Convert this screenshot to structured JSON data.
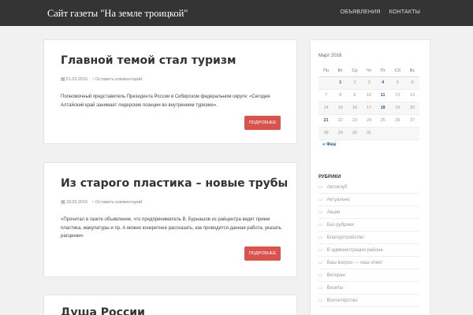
{
  "header": {
    "site_title": "Сайт газеты \"На земле троицкой\"",
    "nav": [
      "ОБЪЯВЛЕНИЯ",
      "КОНТАКТЫ"
    ]
  },
  "posts": [
    {
      "title": "Главной темой стал туризм",
      "date": "21.03.2016",
      "comment_link": "Оставить комментарий",
      "excerpt": "Полномочный представитель Президента России в Сибирском федеральном округе: «Сегодня Алтайский край занимает лидерские позиции во внутреннем туризме».",
      "more": "ПОДРОБНЕЕ"
    },
    {
      "title": "Из старого пластика – новые трубы",
      "date": "18.03.2016",
      "comment_link": "Оставить комментарий",
      "excerpt": "«Прочитал в газете объявление, что предприниматель В. Бурнашов из райцентра ведет прием пластика, макулатуры и пр. А можно конкретнее рассказать, как проводится данная работа, указать расценки»",
      "more": "ПОДРОБНЕЕ"
    },
    {
      "title": "Душа России"
    }
  ],
  "calendar": {
    "caption": "Март 2016",
    "weekdays": [
      "Пн",
      "Вт",
      "Ср",
      "Чт",
      "Пт",
      "Сб",
      "Вс"
    ],
    "weeks": [
      [
        "",
        "1",
        "2",
        "3",
        "4",
        "5",
        "6"
      ],
      [
        "7",
        "8",
        "9",
        "10",
        "11",
        "12",
        "13"
      ],
      [
        "14",
        "15",
        "16",
        "17",
        "18",
        "19",
        "20"
      ],
      [
        "21",
        "22",
        "23",
        "24",
        "25",
        "26",
        "27"
      ],
      [
        "28",
        "29",
        "30",
        "31",
        "",
        "",
        ""
      ]
    ],
    "linked_days": [
      "1",
      "4",
      "11",
      "18",
      "21"
    ],
    "prev": "« Фев"
  },
  "categories": {
    "title": "РУБРИКИ",
    "items": [
      "Автоклуб",
      "Актуально",
      "Акции",
      "Без рубрики",
      "Благоустройство",
      "В администрации района",
      "Ваш вопрос — наш ответ",
      "Ветеран",
      "Визиты",
      "Волонтёрство"
    ]
  },
  "colors": {
    "topbar": "#343434",
    "button": "#d9534f",
    "link": "#2a6496"
  }
}
